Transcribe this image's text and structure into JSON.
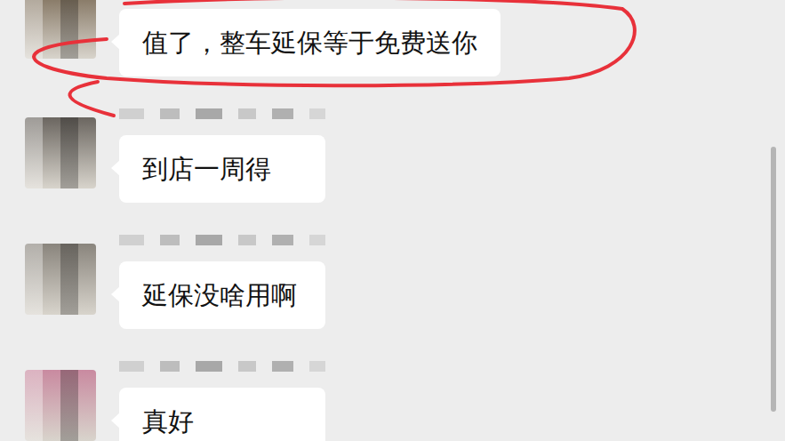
{
  "messages": [
    {
      "text": "值了，整车延保等于免费送你",
      "name_shown": false,
      "highlighted": true,
      "color": "#7a6a55"
    },
    {
      "text": "到店一周得",
      "name_shown": true,
      "highlighted": false,
      "color": "#6b6660"
    },
    {
      "text": "延保没啥用啊",
      "name_shown": true,
      "highlighted": false,
      "color": "#8a857d"
    },
    {
      "text": "真好",
      "name_shown": true,
      "highlighted": false,
      "color": "#c98aa0"
    }
  ],
  "scrollbar": {
    "level": 0.6
  }
}
